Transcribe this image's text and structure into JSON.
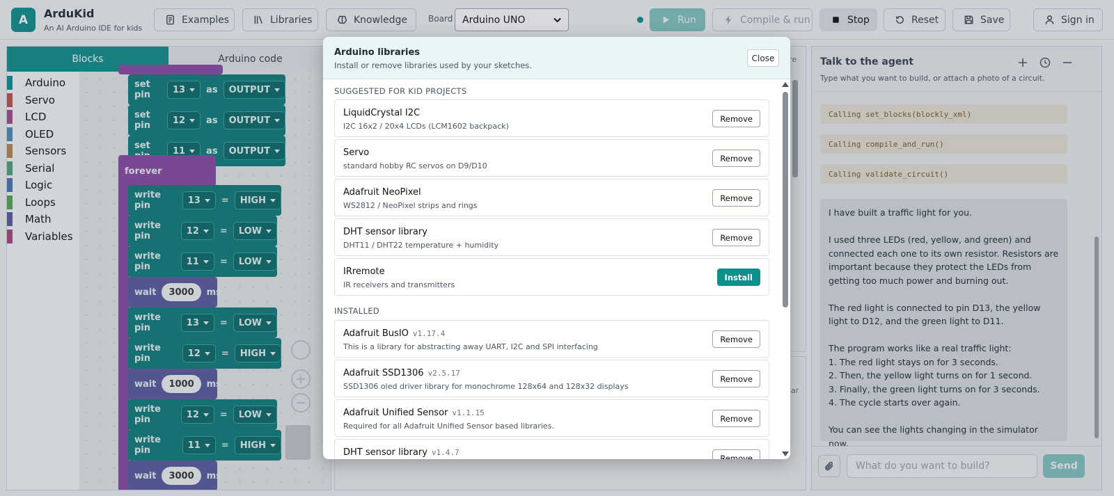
{
  "app": {
    "logo_letter": "A",
    "name": "ArduKid",
    "tagline": "An AI Arduino IDE for kids"
  },
  "toolbar": {
    "examples": "Examples",
    "libraries": "Libraries",
    "knowledge": "Knowledge",
    "board_label": "Board",
    "board_value": "Arduino UNO",
    "run": "Run",
    "compile_run": "Compile & run",
    "stop": "Stop",
    "reset": "Reset",
    "save": "Save",
    "sign_in": "Sign in"
  },
  "editor": {
    "tabs": [
      "Blocks",
      "Arduino code"
    ],
    "categories": [
      {
        "label": "Arduino",
        "color": "#0f8f8c"
      },
      {
        "label": "Servo",
        "color": "#c0504d"
      },
      {
        "label": "LCD",
        "color": "#a34a8b"
      },
      {
        "label": "OLED",
        "color": "#4f8fb5"
      },
      {
        "label": "Sensors",
        "color": "#b58a4f"
      },
      {
        "label": "Serial",
        "color": "#4fa37a"
      },
      {
        "label": "Logic",
        "color": "#4f74b5"
      },
      {
        "label": "Loops",
        "color": "#5ba34f"
      },
      {
        "label": "Math",
        "color": "#5b5a9e"
      },
      {
        "label": "Variables",
        "color": "#a34a7a"
      }
    ],
    "blocks": {
      "setpin": [
        {
          "pin": "13",
          "mode": "OUTPUT"
        },
        {
          "pin": "12",
          "mode": "OUTPUT"
        },
        {
          "pin": "11",
          "mode": "OUTPUT"
        }
      ],
      "set_pin_label": "set pin",
      "as_label": "as",
      "forever": "forever",
      "write_label": "write pin",
      "eq": "=",
      "wait_label": "wait",
      "ms": "ms",
      "seq": [
        {
          "kind": "write",
          "pin": "13",
          "value": "HIGH"
        },
        {
          "kind": "write",
          "pin": "12",
          "value": "LOW"
        },
        {
          "kind": "write",
          "pin": "11",
          "value": "LOW"
        },
        {
          "kind": "wait",
          "value": "3000"
        },
        {
          "kind": "write",
          "pin": "13",
          "value": "LOW"
        },
        {
          "kind": "write",
          "pin": "12",
          "value": "HIGH"
        },
        {
          "kind": "wait",
          "value": "1000"
        },
        {
          "kind": "write",
          "pin": "12",
          "value": "LOW"
        },
        {
          "kind": "write",
          "pin": "11",
          "value": "HIGH"
        },
        {
          "kind": "wait",
          "value": "3000"
        }
      ]
    }
  },
  "chat": {
    "title": "Talk to the agent",
    "subtitle": "Type what you want to build, or attach a photo of a circuit.",
    "calls": [
      "Calling set_blocks(blockly_xml)",
      "Calling compile_and_run()",
      "Calling validate_circuit()"
    ],
    "message": [
      "I have built a traffic light for you.",
      "I used three LEDs (red, yellow, and green) and connected each one to its own resistor. Resistors are important because they protect the LEDs from getting too much power and burning out.",
      "The red light is connected to pin D13, the yellow light to D12, and the green light to D11.",
      "The program works like a real traffic light:\n1. The red light stays on for 3 seconds.\n2. Then, the yellow light turns on for 1 second.\n3. Finally, the green light turns on for 3 seconds.\n4. The cycle starts over again.",
      "You can see the lights changing in the simulator now."
    ],
    "input_placeholder": "What do you want to build?",
    "send": "Send"
  },
  "modal": {
    "title": "Arduino libraries",
    "subtitle": "Install or remove libraries used by your sketches.",
    "close": "Close",
    "suggested_heading": "SUGGESTED FOR KID PROJECTS",
    "installed_heading": "INSTALLED",
    "suggested": [
      {
        "name": "LiquidCrystal I2C",
        "desc": "I2C 16x2 / 20x4 LCDs (LCM1602 backpack)",
        "action": "Remove"
      },
      {
        "name": "Servo",
        "desc": "standard hobby RC servos on D9/D10",
        "action": "Remove"
      },
      {
        "name": "Adafruit NeoPixel",
        "desc": "WS2812 / NeoPixel strips and rings",
        "action": "Remove"
      },
      {
        "name": "DHT sensor library",
        "desc": "DHT11 / DHT22 temperature + humidity",
        "action": "Remove"
      },
      {
        "name": "IRremote",
        "desc": "IR receivers and transmitters",
        "action": "Install"
      }
    ],
    "installed": [
      {
        "name": "Adafruit BusIO",
        "version": "v1.17.4",
        "desc": "This is a library for abstracting away UART, I2C and SPI interfacing",
        "action": "Remove"
      },
      {
        "name": "Adafruit SSD1306",
        "version": "v2.5.17",
        "desc": "SSD1306 oled driver library for monochrome 128x64 and 128x32 displays",
        "action": "Remove"
      },
      {
        "name": "Adafruit Unified Sensor",
        "version": "v1.1.15",
        "desc": "Required for all Adafruit Unified Sensor based libraries.",
        "action": "Remove"
      },
      {
        "name": "DHT sensor library",
        "version": "v1.4.7",
        "desc": "",
        "action": "Remove"
      }
    ]
  },
  "background_fragments": {
    "wire": "wire",
    "clear": "lear"
  }
}
